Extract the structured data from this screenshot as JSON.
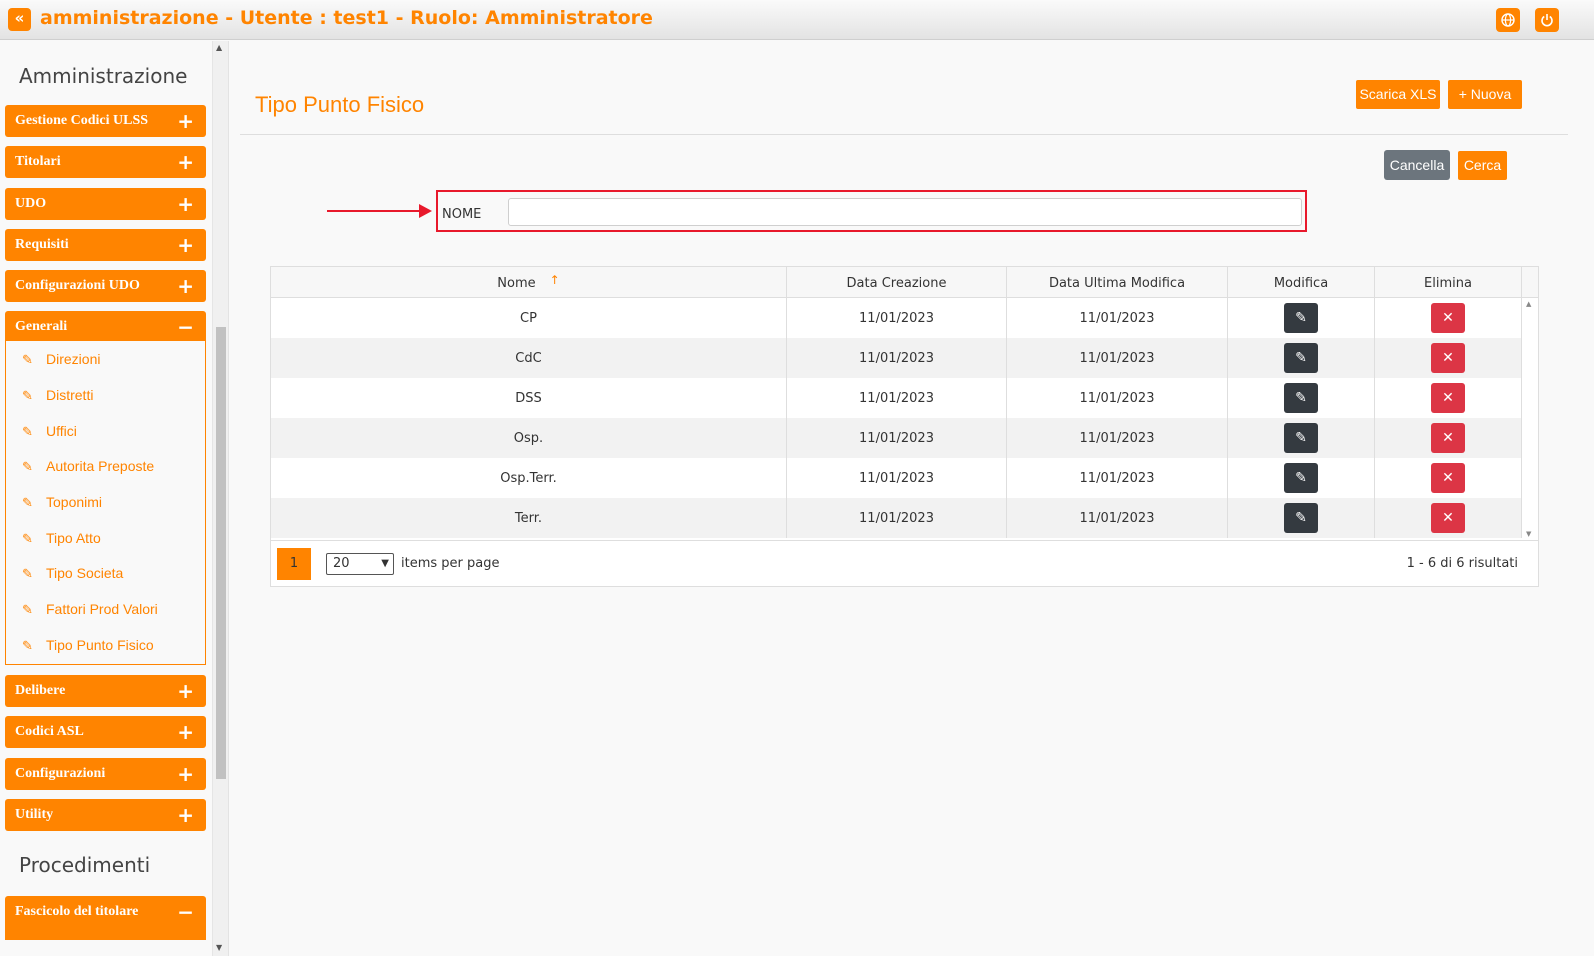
{
  "header": {
    "title": "amministrazione - Utente : test1 - Ruolo: Amministratore",
    "collapse_icon": "«",
    "globe_icon": "globe-icon",
    "power_icon": "power-icon"
  },
  "sidebar": {
    "section1": "Amministrazione",
    "menu": [
      {
        "label": "Gestione Codici ULSS",
        "toggle": "+"
      },
      {
        "label": "Titolari",
        "toggle": "+"
      },
      {
        "label": "UDO",
        "toggle": "+"
      },
      {
        "label": "Requisiti",
        "toggle": "+"
      },
      {
        "label": "Configurazioni UDO",
        "toggle": "+"
      },
      {
        "label": "Generali",
        "toggle": "−"
      },
      {
        "label": "Delibere",
        "toggle": "+"
      },
      {
        "label": "Codici ASL",
        "toggle": "+"
      },
      {
        "label": "Configurazioni",
        "toggle": "+"
      },
      {
        "label": "Utility",
        "toggle": "+"
      }
    ],
    "generali_items": [
      "Direzioni",
      "Distretti",
      "Uffici",
      "Autorita Preposte",
      "Toponimi",
      "Tipo Atto",
      "Tipo Societa",
      "Fattori Prod Valori",
      "Tipo Punto Fisico"
    ],
    "section2": "Procedimenti",
    "menu2": [
      {
        "label": "Fascicolo del titolare",
        "toggle": "−"
      }
    ]
  },
  "main": {
    "title": "Tipo Punto Fisico",
    "scarica_label": "Scarica XLS",
    "nuova_label": "+ Nuova",
    "cancella_label": "Cancella",
    "cerca_label": "Cerca",
    "filter_label": "NOME",
    "filter_value": ""
  },
  "table": {
    "columns": [
      "Nome",
      "Data Creazione",
      "Data Ultima Modifica",
      "Modifica",
      "Elimina"
    ],
    "sort_icon": "↑",
    "rows": [
      {
        "nome": "CP",
        "creazione": "11/01/2023",
        "modifica": "11/01/2023"
      },
      {
        "nome": "CdC",
        "creazione": "11/01/2023",
        "modifica": "11/01/2023"
      },
      {
        "nome": "DSS",
        "creazione": "11/01/2023",
        "modifica": "11/01/2023"
      },
      {
        "nome": "Osp.",
        "creazione": "11/01/2023",
        "modifica": "11/01/2023"
      },
      {
        "nome": "Osp.Terr.",
        "creazione": "11/01/2023",
        "modifica": "11/01/2023"
      },
      {
        "nome": "Terr.",
        "creazione": "11/01/2023",
        "modifica": "11/01/2023"
      }
    ],
    "edit_icon": "✎",
    "delete_icon": "✕"
  },
  "pager": {
    "page": "1",
    "page_size": "20",
    "items_label": "items per page",
    "info": "1 - 6 di 6 risultati"
  },
  "colors": {
    "accent": "#ff8400",
    "danger": "#dc3545",
    "dark": "#343a40",
    "highlight": "#e8192c"
  }
}
